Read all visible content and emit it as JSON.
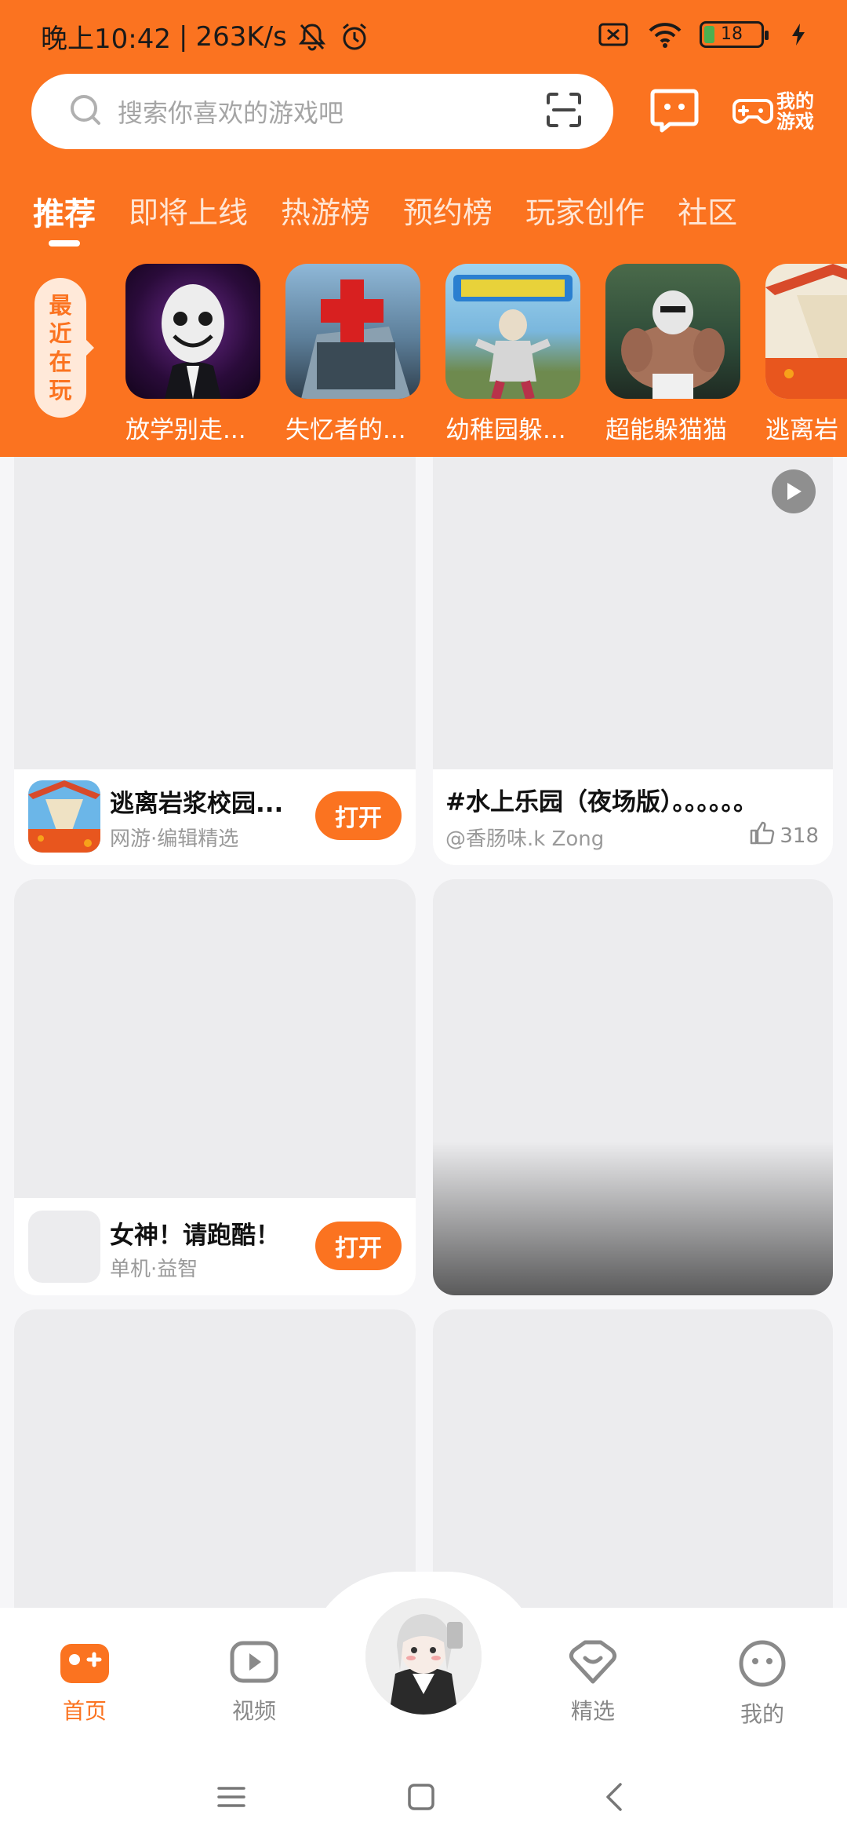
{
  "status_bar": {
    "time": "晚上10:42",
    "speed": "263K/s",
    "battery": "18",
    "battery_fraction": 0.18
  },
  "header": {
    "search_placeholder": "搜索你喜欢的游戏吧",
    "my_games_label_line1": "我的",
    "my_games_label_line2": "游戏",
    "brand_color": "#fb7320"
  },
  "tabs": [
    "推荐",
    "即将上线",
    "热游榜",
    "预约榜",
    "玩家创作",
    "社区"
  ],
  "recent": {
    "label_chars": [
      "最",
      "近",
      "在",
      "玩"
    ],
    "items": [
      {
        "name": "放学别走..."
      },
      {
        "name": "失忆者的..."
      },
      {
        "name": "幼稚园躲..."
      },
      {
        "name": "超能躲猫猫"
      },
      {
        "name": "逃离岩"
      }
    ]
  },
  "feed": {
    "card1": {
      "title": "逃离岩浆校园...",
      "sub": "网游·编辑精选",
      "button": "打开"
    },
    "card2": {
      "title": "#水上乐园（夜场版）。。。。。。",
      "author": "@香肠味.k Zong",
      "likes": "318"
    },
    "card3": {
      "title": "女神！请跑酷！",
      "sub": "单机·益智",
      "button": "打开"
    }
  },
  "bottom_nav": {
    "items": [
      {
        "label": "首页",
        "icon": "gamepad-icon"
      },
      {
        "label": "视频",
        "icon": "video-icon"
      },
      {
        "label": "精选",
        "icon": "heart-icon"
      },
      {
        "label": "我的",
        "icon": "face-icon"
      }
    ]
  }
}
